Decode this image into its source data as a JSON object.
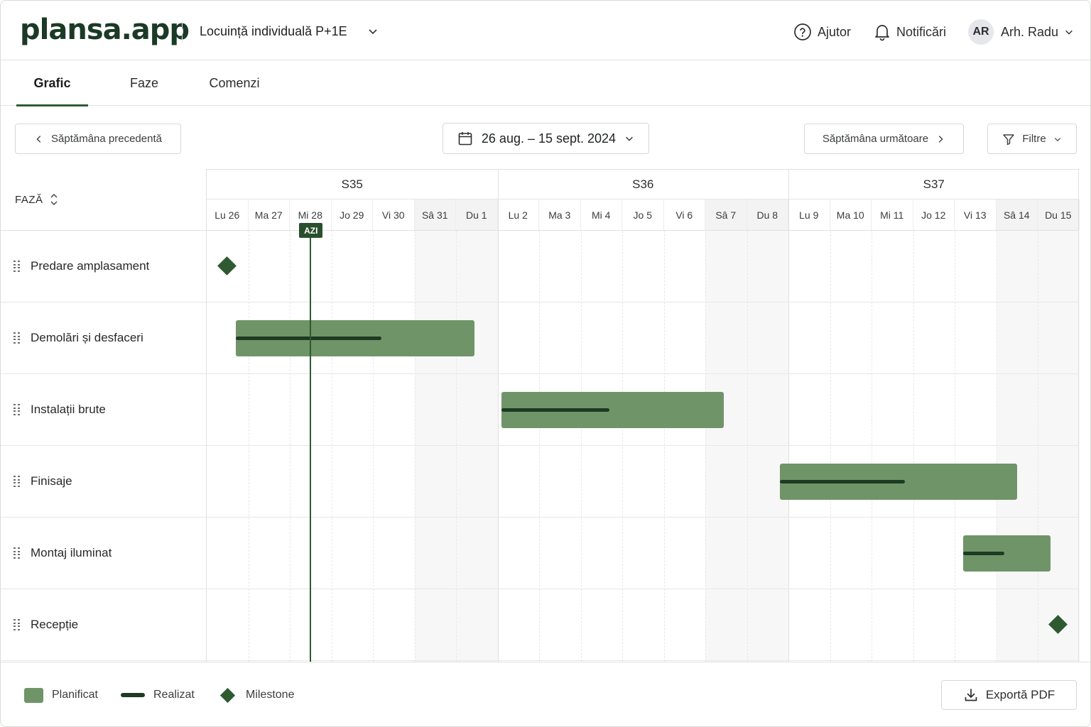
{
  "app": {
    "logo": "plansa.app"
  },
  "header": {
    "project": "Locuință individuală P+1E",
    "help": "Ajutor",
    "notifications": "Notificări",
    "user_initials": "AR",
    "user_name": "Arh. Radu"
  },
  "tabs": [
    {
      "label": "Grafic",
      "active": true
    },
    {
      "label": "Faze",
      "active": false
    },
    {
      "label": "Comenzi",
      "active": false
    }
  ],
  "toolbar": {
    "prev": "Săptămâna precedentă",
    "range": "26 aug. – 15 sept. 2024",
    "next": "Săptămâna următoare",
    "filters": "Filtre"
  },
  "gantt": {
    "phase_header": "FAZĂ",
    "weeks": [
      "S35",
      "S36",
      "S37"
    ],
    "days": [
      "Lu 26",
      "Ma 27",
      "Mi 28",
      "Jo 29",
      "Vi 30",
      "Sâ 31",
      "Du 1",
      "Lu 2",
      "Ma 3",
      "Mi 4",
      "Jo 5",
      "Vi 6",
      "Sâ 7",
      "Du 8",
      "Lu 9",
      "Ma 10",
      "Mi 11",
      "Jo 12",
      "Vi 13",
      "Sâ 14",
      "Du 15"
    ],
    "today_label": "AZI",
    "today_index": 2,
    "rows": [
      {
        "label": "Predare amplasament",
        "type": "milestone",
        "day": 0
      },
      {
        "label": "Demolări și desfaceri",
        "type": "bar",
        "start": 0.7,
        "end": 6.45,
        "actual_end": 4.2
      },
      {
        "label": "Instalații brute",
        "type": "bar",
        "start": 7.1,
        "end": 12.45,
        "actual_end": 9.7
      },
      {
        "label": "Finisaje",
        "type": "bar",
        "start": 13.8,
        "end": 19.5,
        "actual_end": 16.8
      },
      {
        "label": "Montaj iluminat",
        "type": "bar",
        "start": 18.2,
        "end": 20.3,
        "actual_end": 19.2
      },
      {
        "label": "Recepție",
        "type": "milestone",
        "day": 20
      }
    ]
  },
  "legend": {
    "planned": "Planificat",
    "actual": "Realizat",
    "milestone": "Milestone"
  },
  "footer": {
    "export": "Exportă PDF"
  },
  "colors": {
    "planned": "#6f9468",
    "actual": "#1d3a22",
    "milestone": "#2f5a31",
    "accent": "#2e5e35"
  }
}
